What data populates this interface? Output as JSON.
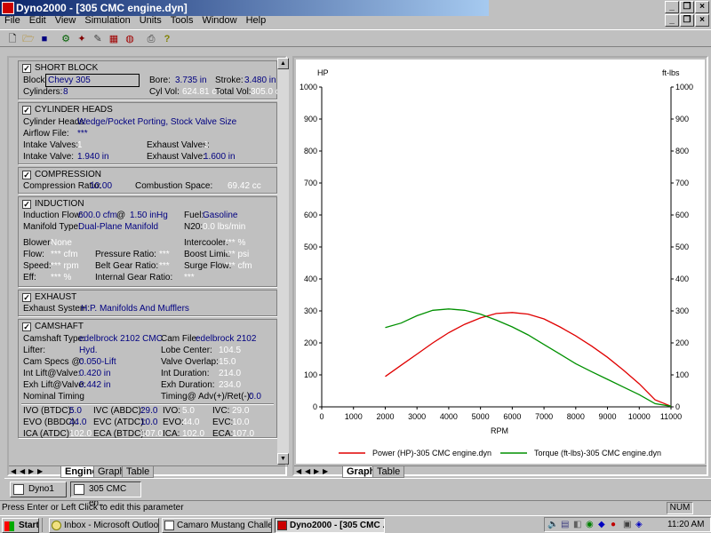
{
  "window": {
    "title": "Dyno2000 - [305 CMC engine.dyn]"
  },
  "menu": [
    "File",
    "Edit",
    "View",
    "Simulation",
    "Units",
    "Tools",
    "Window",
    "Help"
  ],
  "toolbar_icons": [
    "new-icon",
    "open-icon",
    "save-icon",
    "run-icon",
    "tool-icon",
    "wrench-icon",
    "chart-icon",
    "gauge-icon",
    "print-icon",
    "help-icon"
  ],
  "short_block": {
    "title": "SHORT BLOCK",
    "checked": "✓",
    "block_label": "Block:",
    "block": "Chevy 305",
    "bore_label": "Bore:",
    "bore": "3.735 in",
    "stroke_label": "Stroke:",
    "stroke": "3.480 in",
    "cyl_label": "Cylinders:",
    "cyl": "8",
    "cylvol_label": "Cyl Vol:",
    "cylvol": "624.81 cc",
    "totvol_label": "Total Vol:",
    "totvol": "305.0 ci"
  },
  "cyl_heads": {
    "title": "CYLINDER HEADS",
    "checked": "✓",
    "heads_label": "Cylinder Heads:",
    "heads": "Wedge/Pocket Porting, Stock Valve Size",
    "airflow_label": "Airflow File:",
    "airflow": "***",
    "intake_valves_label": "Intake Valves:",
    "intake_valves": "1",
    "exhaust_valves_label": "Exhaust Valves:",
    "exhaust_valves": "1",
    "intake_valve_label": "Intake Valve:",
    "intake_valve": "1.940 in",
    "exhaust_valve_label": "Exhaust Valve:",
    "exhaust_valve": "1.600 in"
  },
  "compression": {
    "title": "COMPRESSION",
    "checked": "✓",
    "ratio_label": "Compression Ratio:",
    "ratio": "10.00",
    "space_label": "Combustion Space:",
    "space": "69.42 cc"
  },
  "induction": {
    "title": "INDUCTION",
    "checked": "✓",
    "flow_label": "Induction Flow:",
    "flow": "600.0 cfm",
    "at": "@",
    "flow_at": "1.50 inHg",
    "fuel_label": "Fuel:",
    "fuel": "Gasoline",
    "manifold_label": "Manifold Type:",
    "manifold": "Dual-Plane Manifold",
    "n20_label": "N20:",
    "n20": "0.0 lbs/min",
    "blower_label": "Blower:",
    "blower": "None",
    "intercooler_label": "Intercooler:",
    "intercooler": "*** %",
    "flow2_label": "Flow:",
    "flow2": "*** cfm",
    "pressure_label": "Pressure Ratio:",
    "pressure": "***",
    "boost_label": "Boost Limit:",
    "boost": "*** psi",
    "speed_label": "Speed:",
    "speed": "*** rpm",
    "belt_label": "Belt Gear Ratio:",
    "belt": "***",
    "surge_label": "Surge Flow:",
    "surge": "*** cfm",
    "eff_label": "Eff:",
    "eff": "*** %",
    "internal_label": "Internal Gear Ratio:",
    "internal": "***"
  },
  "exhaust": {
    "title": "EXHAUST",
    "checked": "✓",
    "system_label": "Exhaust System:",
    "system": "H.P. Manifolds And Mufflers"
  },
  "camshaft": {
    "title": "CAMSHAFT",
    "checked": "✓",
    "type_label": "Camshaft Type:",
    "type": "edelbrock 2102 CMC",
    "file_label": "Cam File:",
    "file": "edelbrock 2102",
    "lifter_label": "Lifter:",
    "lifter": "Hyd.",
    "lobe_label": "Lobe Center:",
    "lobe": "104.5",
    "specs_label": "Cam Specs @:",
    "specs": "0.050-Lift",
    "overlap_label": "Valve Overlap:",
    "overlap": "15.0",
    "intlift_label": "Int Lift@Valve:",
    "intlift": "0.420 in",
    "intdur_label": "Int Duration:",
    "intdur": "214.0",
    "exhlift_label": "Exh Lift@Valve:",
    "exhlift": "0.442 in",
    "exhdur_label": "Exh Duration:",
    "exhdur": "234.0",
    "nominal_label": "Nominal Timing",
    "timing_label": "Timing@ Adv(+)/Ret(-):",
    "timing": "0.0",
    "ivo_btdc_label": "IVO (BTDC):",
    "ivo_btdc": "5.0",
    "ivc_abdc_label": "IVC (ABDC):",
    "ivc_abdc": "29.0",
    "ivo_label": "IVO:",
    "ivo": "5.0",
    "ivc_label": "IVC:",
    "ivc": "29.0",
    "evo_bbdc_label": "EVO (BBDC):",
    "evo_bbdc": "44.0",
    "evc_atdc_label": "EVC (ATDC):",
    "evc_atdc": "10.0",
    "evo_label": "EVO:",
    "evo": "44.0",
    "evc_label": "EVC:",
    "evc": "10.0",
    "ica_atdc_label": "ICA (ATDC):",
    "ica_atdc": "102.0",
    "eca_btdc_label": "ECA (BTDC):",
    "eca_btdc": "107.0",
    "ica_label": "ICA:",
    "ica": "102.0",
    "eca_label": "ECA:",
    "eca": "107.0"
  },
  "left_tabs": [
    "Engine",
    "Graph",
    "Table"
  ],
  "right_tabs": [
    "Graph",
    "Table"
  ],
  "mdi_windows": [
    "Dyno1",
    "305 CMC en..."
  ],
  "status": {
    "text": "Press Enter or Left Click to edit this parameter",
    "num": "NUM"
  },
  "taskbar": {
    "start": "Start",
    "items": [
      "Inbox - Microsoft Outlook",
      "Camaro Mustang Challen...",
      "Dyno2000 - [305 CMC ..."
    ],
    "clock": "11:20 AM"
  },
  "colors": {
    "power": "#e00000",
    "torque": "#009000",
    "value": "#000080",
    "ghost": "#ffffff"
  },
  "chart_data": {
    "type": "line",
    "left_axis_title": "HP",
    "right_axis_title": "ft-lbs",
    "xlabel": "RPM",
    "xlim": [
      0,
      11000
    ],
    "ylim": [
      0,
      1000
    ],
    "xticks": [
      0,
      1000,
      2000,
      3000,
      4000,
      5000,
      6000,
      7000,
      8000,
      9000,
      10000,
      11000
    ],
    "yticks": [
      0,
      100,
      200,
      300,
      400,
      500,
      600,
      700,
      800,
      900,
      1000
    ],
    "grid": false,
    "legend_position": "bottom",
    "series": [
      {
        "name": "Power (HP)-305 CMC engine.dyn",
        "color": "#e00000",
        "x": [
          2000,
          2500,
          3000,
          3500,
          4000,
          4500,
          5000,
          5500,
          6000,
          6500,
          7000,
          7500,
          8000,
          8500,
          9000,
          9500,
          10000,
          10500,
          11000
        ],
        "y": [
          95,
          130,
          165,
          200,
          232,
          258,
          278,
          292,
          295,
          290,
          275,
          250,
          222,
          190,
          155,
          115,
          72,
          22,
          2
        ]
      },
      {
        "name": "Torque (ft-lbs)-305 CMC engine.dyn",
        "color": "#009000",
        "x": [
          2000,
          2500,
          3000,
          3500,
          4000,
          4500,
          5000,
          5500,
          6000,
          6500,
          7000,
          7500,
          8000,
          8500,
          9000,
          9500,
          10000,
          10500,
          11000
        ],
        "y": [
          248,
          262,
          285,
          302,
          306,
          302,
          290,
          271,
          250,
          225,
          195,
          165,
          135,
          110,
          86,
          62,
          38,
          10,
          2
        ]
      }
    ]
  }
}
